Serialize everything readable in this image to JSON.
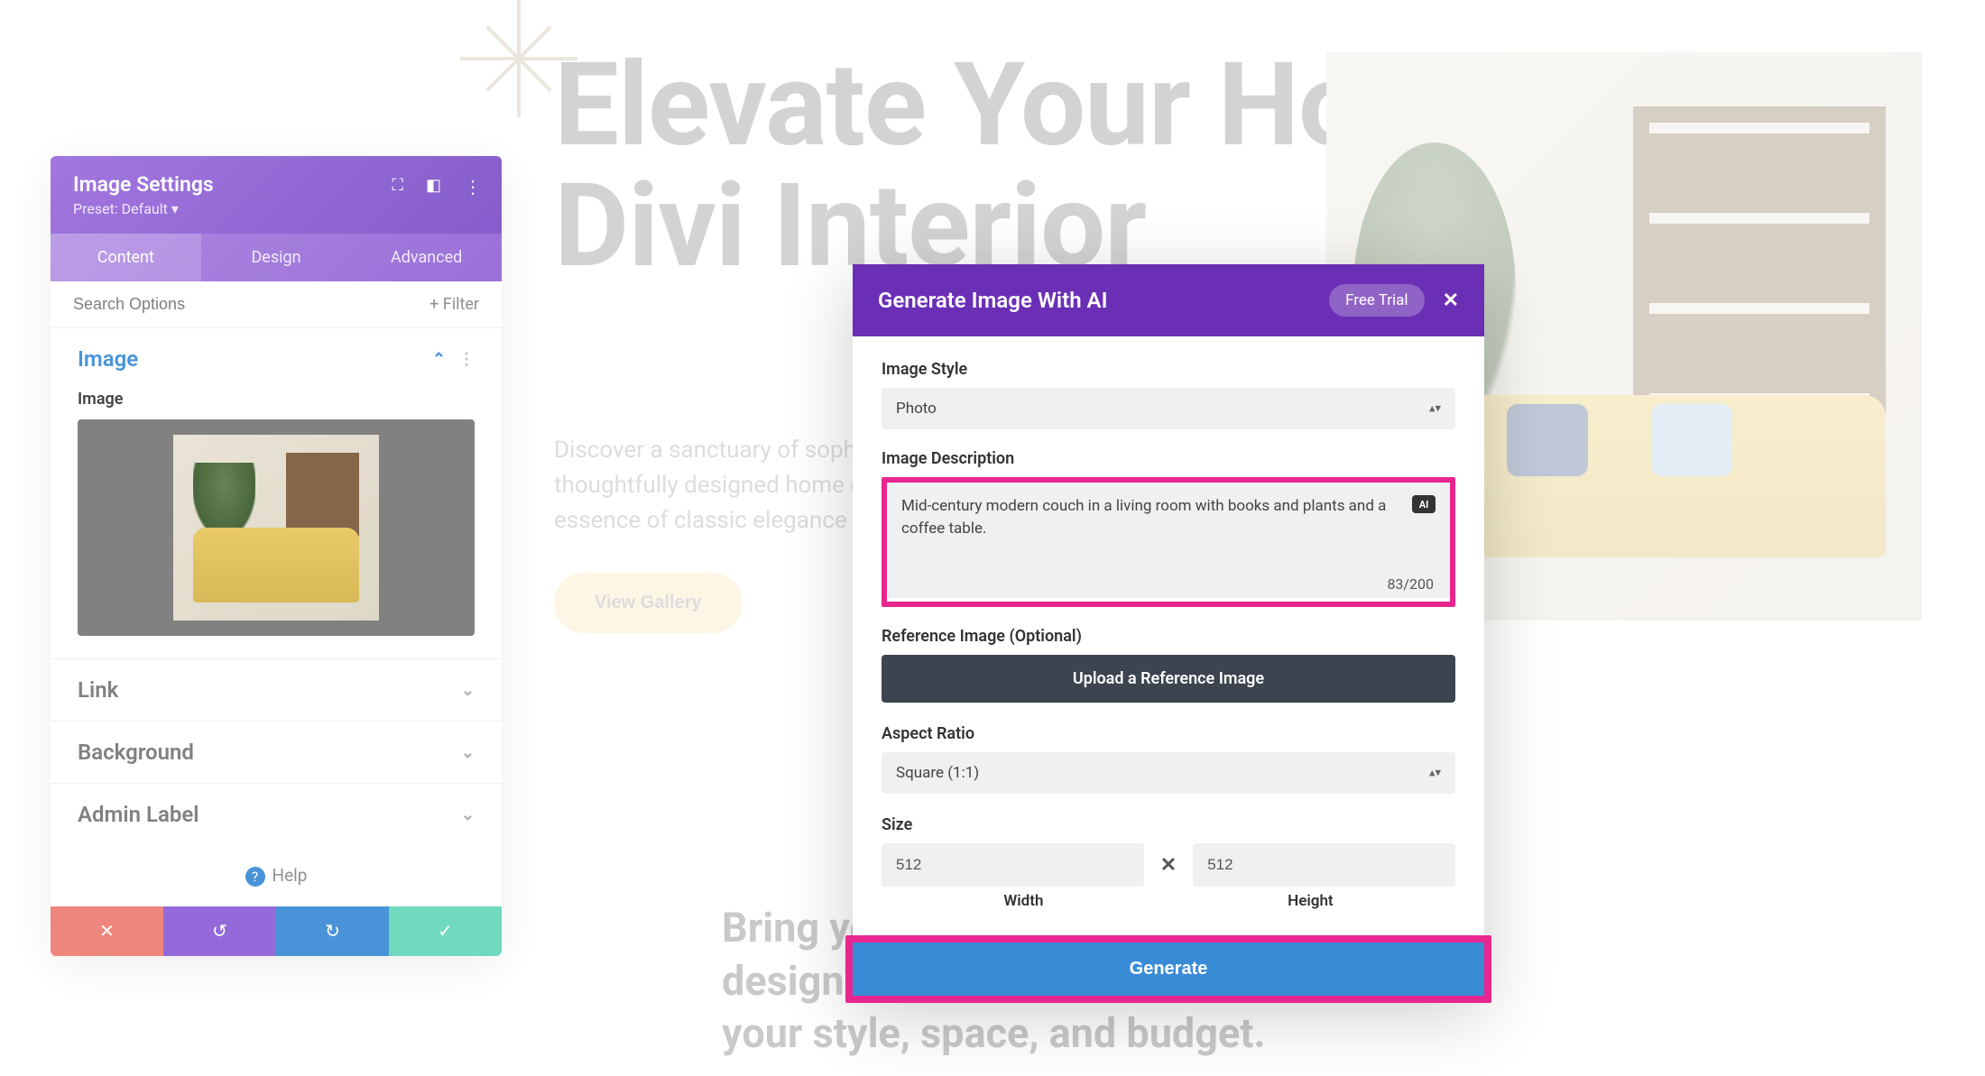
{
  "page": {
    "hero_title": "Elevate Your Home With Divi Interior",
    "hero_text": "Discover a sanctuary of sophistication at home – where our thoughtfully designed home decor pieces brings together the essence of classic elegance and contemporary charm.",
    "hero_button": "View Gallery",
    "secondary_title_line1": "Bring your vision to life with one-on-one",
    "secondary_title_line2": "design consultations tailored to",
    "secondary_title_line3": "your style, space, and budget."
  },
  "settings": {
    "title": "Image Settings",
    "preset_label": "Preset: Default",
    "tabs": {
      "content": "Content",
      "design": "Design",
      "advanced": "Advanced"
    },
    "search_placeholder": "Search Options",
    "filter_label": "Filter",
    "sections": {
      "image": "Image",
      "image_field": "Image",
      "link": "Link",
      "background": "Background",
      "admin_label": "Admin Label"
    },
    "help_label": "Help"
  },
  "ai": {
    "title": "Generate Image With AI",
    "trial_label": "Free Trial",
    "style_label": "Image Style",
    "style_value": "Photo",
    "desc_label": "Image Description",
    "desc_value": "Mid-century modern couch in a living room with books and plants and a coffee table.",
    "char_count": "83/200",
    "ai_badge": "AI",
    "ref_label": "Reference Image (Optional)",
    "upload_label": "Upload a Reference Image",
    "aspect_label": "Aspect Ratio",
    "aspect_value": "Square (1:1)",
    "size_label": "Size",
    "width_value": "512",
    "height_value": "512",
    "width_label": "Width",
    "height_label": "Height",
    "generate_label": "Generate"
  }
}
